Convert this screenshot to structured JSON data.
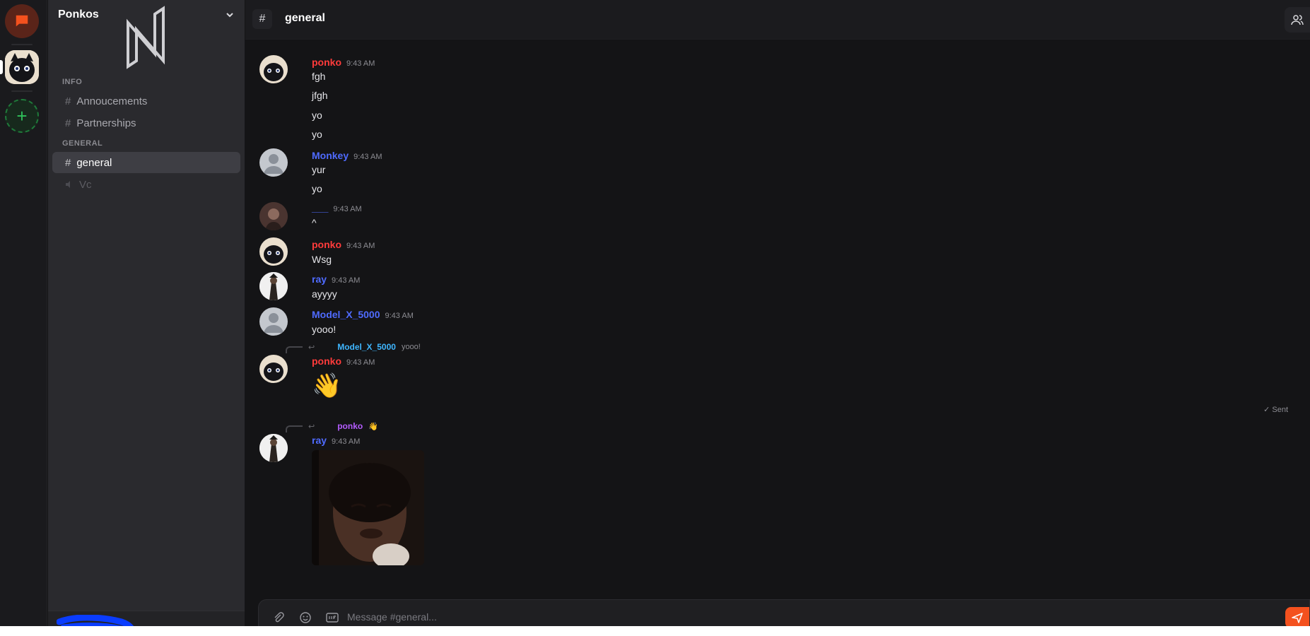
{
  "server": {
    "name": "Ponkos"
  },
  "sidebar": {
    "categories": [
      {
        "label": "INFO",
        "channels": [
          {
            "name": "Annoucements"
          },
          {
            "name": "Partnerships"
          }
        ]
      },
      {
        "label": "GENERAL",
        "channels": [
          {
            "name": "general",
            "active": true
          },
          {
            "name": "Vc",
            "type": "voice"
          }
        ]
      }
    ]
  },
  "header": {
    "hash": "#",
    "channel": "general"
  },
  "colors": {
    "accent": "#f4511e",
    "ponko": "#ff3b3b",
    "blue_user": "#4f6bff",
    "reply_cyan": "#3fb6ff",
    "reply_purple": "#b45cff",
    "add_green": "#2fbf5a"
  },
  "messages": [
    {
      "author": "ponko",
      "time": "9:43 AM",
      "lines": [
        "fgh",
        "jfgh",
        "yo",
        "yo"
      ]
    },
    {
      "author": "Monkey",
      "time": "9:43 AM",
      "lines": [
        "yur",
        "yo"
      ]
    },
    {
      "author": "___",
      "time": "9:43 AM",
      "lines": [
        "^"
      ]
    },
    {
      "author": "ponko",
      "time": "9:43 AM",
      "lines": [
        "Wsg"
      ]
    },
    {
      "author": "ray",
      "time": "9:43 AM",
      "lines": [
        "ayyyy"
      ]
    },
    {
      "author": "Model_X_5000",
      "time": "9:43 AM",
      "lines": [
        "yooo!"
      ]
    },
    {
      "reply_to": {
        "author": "Model_X_5000",
        "text": "yooo!"
      },
      "author": "ponko",
      "time": "9:43 AM",
      "emoji": "👋",
      "status": "✓ Sent"
    },
    {
      "reply_to": {
        "author": "ponko",
        "text": "👋"
      },
      "author": "ray",
      "time": "9:43 AM",
      "attachment": "image"
    }
  ],
  "composer": {
    "placeholder": "Message #general..."
  }
}
